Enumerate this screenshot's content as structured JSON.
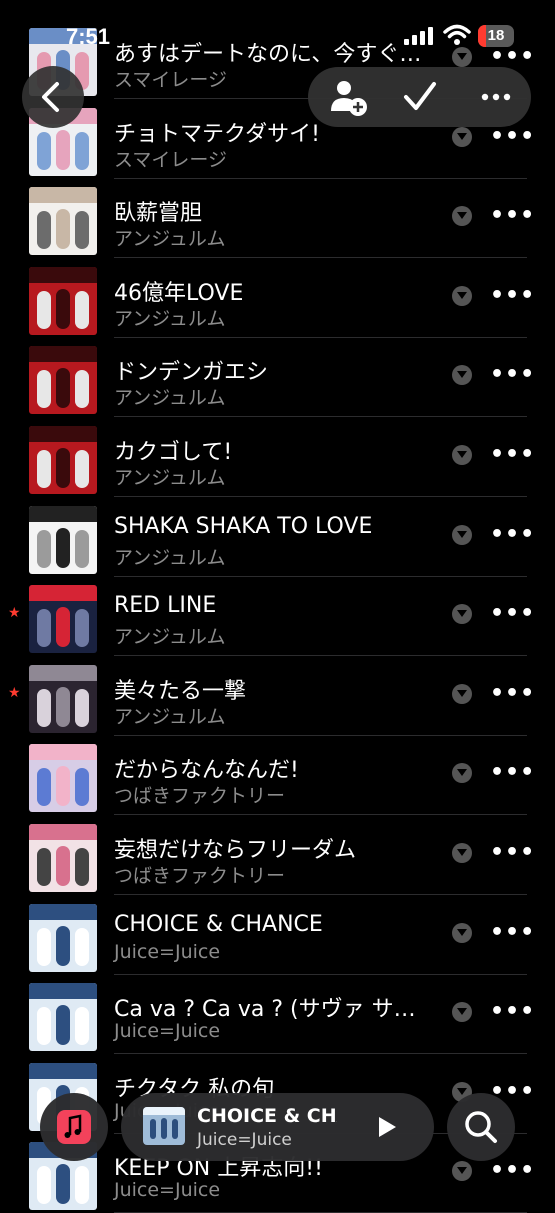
{
  "status_bar": {
    "time": "7:51",
    "battery": "18"
  },
  "colors": {
    "accent": "#ff3b30",
    "background": "#000000",
    "secondary_text": "#8c8c8c"
  },
  "top_bar": {
    "back_icon": "chevron-left-icon",
    "actions": [
      "add-person-icon",
      "checkmark-icon",
      "ellipsis-icon"
    ]
  },
  "songs": [
    {
      "title": "あすはデートなのに、今すぐいいたい",
      "artist": "スマイレージ",
      "starred": false
    },
    {
      "title": "チョトマテクダサイ!",
      "artist": "スマイレージ",
      "starred": false
    },
    {
      "title": "臥薪嘗胆",
      "artist": "アンジュルム",
      "starred": false
    },
    {
      "title": "46億年LOVE",
      "artist": "アンジュルム",
      "starred": false
    },
    {
      "title": "ドンデンガエシ",
      "artist": "アンジュルム",
      "starred": false
    },
    {
      "title": "カクゴして!",
      "artist": "アンジュルム",
      "starred": false
    },
    {
      "title": "SHAKA SHAKA TO LOVE",
      "artist": "アンジュルム",
      "starred": false
    },
    {
      "title": "RED LINE",
      "artist": "アンジュルム",
      "starred": true
    },
    {
      "title": "美々たる一撃",
      "artist": "アンジュルム",
      "starred": true
    },
    {
      "title": "だからなんなんだ!",
      "artist": "つばきファクトリー",
      "starred": false
    },
    {
      "title": "妄想だけならフリーダム",
      "artist": "つばきファクトリー",
      "starred": false
    },
    {
      "title": "CHOICE & CHANCE",
      "artist": "Juice=Juice",
      "starred": false
    },
    {
      "title": "Ca va ? Ca va ? (サヴァ サヴァ)",
      "artist": "Juice=Juice",
      "starred": false
    },
    {
      "title": "チクタク 私の旬",
      "artist": "Juice=Juice",
      "starred": false
    },
    {
      "title": "KEEP ON 上昇志向!!",
      "artist": "Juice=Juice",
      "starred": false
    }
  ],
  "now_playing": {
    "title": "CHOICE & CHANCE",
    "artist": "Juice=Juice"
  }
}
